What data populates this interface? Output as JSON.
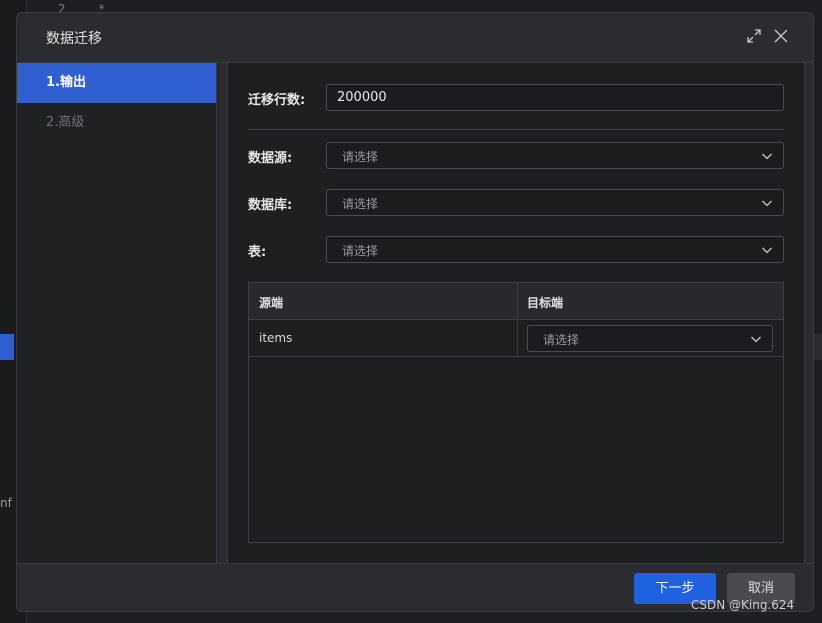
{
  "background": {
    "line_number": "2",
    "line_text": "*",
    "partial_text": "nf"
  },
  "dialog": {
    "title": "数据迁移",
    "icons": {
      "expand": "expand-icon",
      "close": "close-icon"
    }
  },
  "sidebar": {
    "items": [
      {
        "label": "1.输出",
        "active": true
      },
      {
        "label": "2.高级",
        "active": false
      }
    ]
  },
  "form": {
    "rows_label": "迁移行数:",
    "rows_value": "200000",
    "datasource_label": "数据源:",
    "datasource_placeholder": "请选择",
    "database_label": "数据库:",
    "database_placeholder": "请选择",
    "table_label": "表:",
    "table_placeholder": "请选择"
  },
  "mapping_table": {
    "headers": [
      "源端",
      "目标端"
    ],
    "rows": [
      {
        "source": "items",
        "target_placeholder": "请选择"
      }
    ]
  },
  "footer": {
    "next_label": "下一步",
    "cancel_label": "取消"
  },
  "watermark": "CSDN @King.624",
  "colors": {
    "accent": "#2f5fd0",
    "primary_button": "#1e62e0",
    "dialog_bg": "#2b2c2f"
  }
}
